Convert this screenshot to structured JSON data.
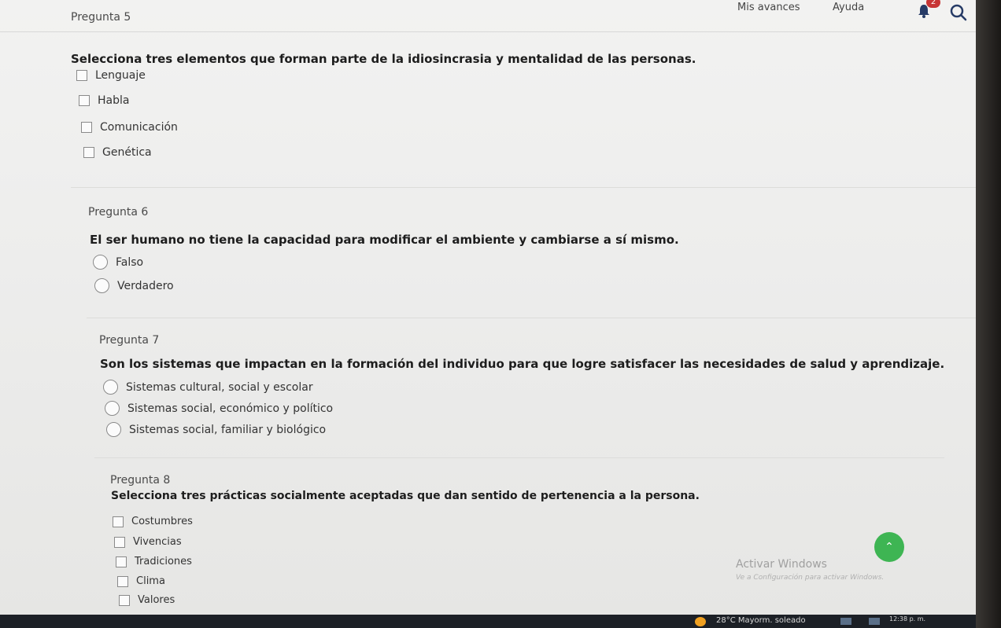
{
  "header": {
    "progress_link": "Mis avances",
    "help_link": "Ayuda",
    "notification_count": "2"
  },
  "questions": [
    {
      "number": "Pregunta 5",
      "text": "Selecciona tres elementos que forman parte de la idiosincrasia y mentalidad de las personas.",
      "type": "checkbox",
      "options": [
        "Lenguaje",
        "Habla",
        "Comunicación",
        "Genética"
      ]
    },
    {
      "number": "Pregunta 6",
      "text": "El ser humano no tiene la capacidad para modificar el ambiente y cambiarse a sí mismo.",
      "type": "radio",
      "options": [
        "Falso",
        "Verdadero"
      ]
    },
    {
      "number": "Pregunta 7",
      "text": "Son los sistemas que impactan en la formación del individuo para que logre satisfacer las necesidades de salud y aprendizaje.",
      "type": "radio",
      "options": [
        "Sistemas cultural, social y escolar",
        "Sistemas social, económico y político",
        "Sistemas social, familiar y biológico"
      ]
    },
    {
      "number": "Pregunta 8",
      "text": "Selecciona tres prácticas socialmente aceptadas que dan sentido de pertenencia a la persona.",
      "type": "checkbox",
      "options": [
        "Costumbres",
        "Vivencias",
        "Tradiciones",
        "Clima",
        "Valores"
      ]
    }
  ],
  "watermark": {
    "title": "Activar Windows",
    "subtitle": "Ve a Configuración para activar Windows."
  },
  "taskbar": {
    "weather": "28°C  Mayorm. soleado",
    "time": "12:38 p. m."
  },
  "colors": {
    "scroll_button": "#3eb553",
    "badge": "#c73535"
  }
}
